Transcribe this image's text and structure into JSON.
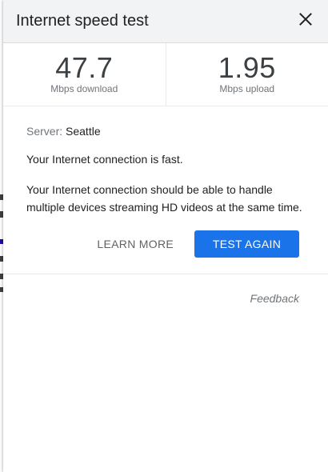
{
  "dialog": {
    "title": "Internet speed test"
  },
  "download": {
    "value": "47.7",
    "unit": "Mbps download"
  },
  "upload": {
    "value": "1.95",
    "unit": "Mbps upload"
  },
  "server": {
    "label": "Server:",
    "name": "Seattle"
  },
  "status_text": "Your Internet connection is fast.",
  "description": "Your Internet connection should be able to handle multiple devices streaming HD videos at the same time.",
  "actions": {
    "learn_more": "LEARN MORE",
    "test_again": "TEST AGAIN"
  },
  "feedback": "Feedback",
  "colors": {
    "primary_button": "#1a73e8",
    "header_bg": "#f1f3f4"
  },
  "icons": {
    "close": "close-icon"
  }
}
